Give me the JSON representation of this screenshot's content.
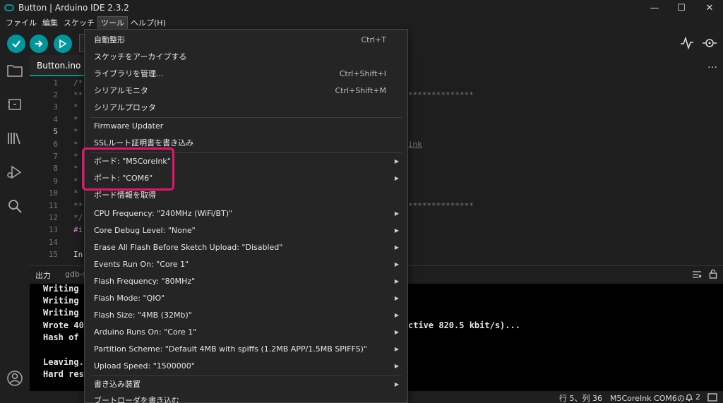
{
  "window": {
    "title": "Button | Arduino IDE 2.3.2",
    "minimize": "—",
    "maximize": "☐",
    "close": "✕"
  },
  "menubar": [
    "ファイル",
    "編集",
    "スケッチ",
    "ツール",
    "ヘルプ(H)"
  ],
  "editor": {
    "tab": "Button.ino",
    "more": "…",
    "line_numbers": [
      "1",
      "2",
      "3",
      "4",
      "5",
      "6",
      "7",
      "8",
      "9",
      "10",
      "11",
      "12",
      "13",
      "14",
      "15"
    ],
    "current_line": "5",
    "code_left": [
      "/*",
      "**",
      "*",
      "*",
      "*",
      "*",
      "*",
      "*",
      "*",
      "*",
      "**",
      "*/",
      "#i",
      "",
      "In"
    ],
    "code_right_stars_1": "**************",
    "code_right_link": "ink",
    "code_right_stars_2": "**************"
  },
  "output": {
    "tab": "出力",
    "tab2": "gdb-s",
    "lines": [
      "Writing ",
      "Writing ",
      "Writing ",
      "Wrote 40",
      "Hash of ",
      "",
      "Leaving.",
      "Hard res"
    ],
    "line_right": "ctive 820.5 kbit/s)..."
  },
  "statusbar": {
    "position": "行 5、列 36",
    "board": "M5CoreInk COM6の",
    "notifications": "2"
  },
  "tools_menu": {
    "items": [
      {
        "label": "自動整形",
        "shortcut": "Ctrl+T",
        "submenu": false
      },
      {
        "label": "スケッチをアーカイブする",
        "shortcut": "",
        "submenu": false
      },
      {
        "label": "ライブラリを管理...",
        "shortcut": "Ctrl+Shift+I",
        "submenu": false
      },
      {
        "label": "シリアルモニタ",
        "shortcut": "Ctrl+Shift+M",
        "submenu": false
      },
      {
        "label": "シリアルプロッタ",
        "shortcut": "",
        "submenu": false
      },
      {
        "label": "Firmware Updater",
        "shortcut": "",
        "submenu": false
      },
      {
        "label": "SSLルート証明書を書き込み",
        "shortcut": "",
        "submenu": false
      },
      {
        "label": "ボード: \"M5CoreInk\"",
        "shortcut": "",
        "submenu": true
      },
      {
        "label": "ポート: \"COM6\"",
        "shortcut": "",
        "submenu": true
      },
      {
        "label": "ボード情報を取得",
        "shortcut": "",
        "submenu": false
      },
      {
        "label": "CPU Frequency: \"240MHz (WiFi/BT)\"",
        "shortcut": "",
        "submenu": true
      },
      {
        "label": "Core Debug Level: \"None\"",
        "shortcut": "",
        "submenu": true
      },
      {
        "label": "Erase All Flash Before Sketch Upload: \"Disabled\"",
        "shortcut": "",
        "submenu": true
      },
      {
        "label": "Events Run On: \"Core 1\"",
        "shortcut": "",
        "submenu": true
      },
      {
        "label": "Flash Frequency: \"80MHz\"",
        "shortcut": "",
        "submenu": true
      },
      {
        "label": "Flash Mode: \"QIO\"",
        "shortcut": "",
        "submenu": true
      },
      {
        "label": "Flash Size: \"4MB (32Mb)\"",
        "shortcut": "",
        "submenu": true
      },
      {
        "label": "Arduino Runs On: \"Core 1\"",
        "shortcut": "",
        "submenu": true
      },
      {
        "label": "Partition Scheme: \"Default 4MB with spiffs (1.2MB APP/1.5MB SPIFFS)\"",
        "shortcut": "",
        "submenu": true
      },
      {
        "label": "Upload Speed: \"1500000\"",
        "shortcut": "",
        "submenu": true
      },
      {
        "label": "書き込み装置",
        "shortcut": "",
        "submenu": true
      },
      {
        "label": "ブートローダを書き込む",
        "shortcut": "",
        "submenu": false
      }
    ],
    "arrow": "▶"
  },
  "colors": {
    "accent": "#00979c",
    "highlight": "#e6156b"
  }
}
